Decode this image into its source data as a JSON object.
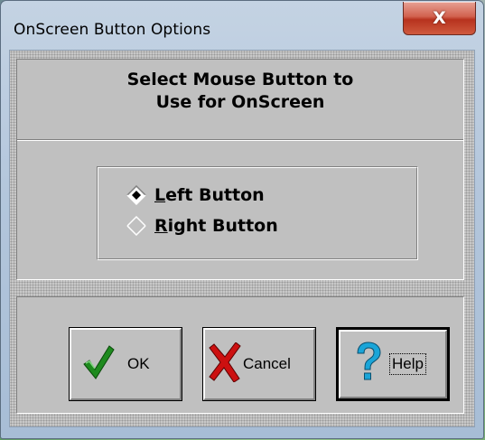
{
  "window": {
    "title": "OnScreen Button Options",
    "close_symbol": "X"
  },
  "heading": {
    "line1": "Select Mouse Button to",
    "line2": "Use for OnScreen"
  },
  "options": [
    {
      "mnemonic": "L",
      "rest": "eft Button",
      "selected": true
    },
    {
      "mnemonic": "R",
      "rest": "ight Button",
      "selected": false
    }
  ],
  "buttons": {
    "ok": {
      "label": "OK",
      "icon": "checkmark-icon",
      "color": "#1e8a1e"
    },
    "cancel": {
      "label": "Cancel",
      "icon": "red-x-icon",
      "color": "#cc1010"
    },
    "help": {
      "label": "Help",
      "icon": "question-mark-icon",
      "color": "#1aa5d8"
    }
  }
}
